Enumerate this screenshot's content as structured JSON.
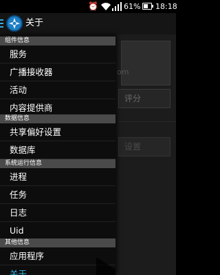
{
  "status_bar": {
    "battery_percent": "61%",
    "battery_level": 0.61,
    "time": "18:18"
  },
  "action_bar": {
    "title": "关于"
  },
  "background": {
    "partial_text": "om",
    "rate_button": "评分",
    "settings_button": "设置"
  },
  "drawer": {
    "sections": [
      {
        "header": "组件信息",
        "items": [
          "服务",
          "广播接收器",
          "活动",
          "内容提供商"
        ]
      },
      {
        "header": "数据信息",
        "items": [
          "共享偏好设置",
          "数据库"
        ]
      },
      {
        "header": "系统运行信息",
        "items": [
          "进程",
          "任务",
          "日志",
          "Uid"
        ]
      },
      {
        "header": "其他信息",
        "items": [
          "应用程序",
          "关于"
        ]
      }
    ],
    "active_item": "关于"
  },
  "colors": {
    "accent": "#33b5e5",
    "section_header": "#4a4a4a",
    "drawer_bg": "#0d0d0d"
  }
}
